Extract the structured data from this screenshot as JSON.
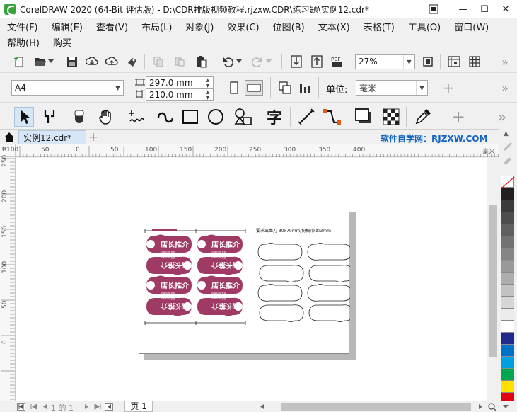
{
  "window": {
    "title": "CorelDRAW 2020 (64-Bit 评估版) - D:\\CDR排版视频教程.rjzxw.CDR\\练习题\\实例12.cdr*",
    "controls": {
      "restore": "▭",
      "minimize": "—",
      "maximize": "☐",
      "close": "✕"
    }
  },
  "menu": {
    "row1": [
      "文件(F)",
      "编辑(E)",
      "查看(V)",
      "布局(L)",
      "对象(J)",
      "效果(C)",
      "位图(B)",
      "文本(X)",
      "表格(T)",
      "工具(O)",
      "窗口(W)"
    ],
    "row2": [
      "帮助(H)",
      "购买"
    ]
  },
  "standard_toolbar": {
    "zoom": "27%",
    "more": "»"
  },
  "property_bar": {
    "page_size": "A4",
    "width": "297.0 mm",
    "height": "210.0 mm",
    "units_label": "单位:",
    "units_value": "毫米",
    "add": "+"
  },
  "toolbox": {
    "text_tool_glyph": "字",
    "add": "+",
    "more": "»"
  },
  "document_tab": {
    "name": "实例12.cdr*",
    "add": "+",
    "watermark": "软件自学网：RJZXW.COM"
  },
  "ruler": {
    "h_labels": [
      "100",
      "50",
      "0",
      "50",
      "100",
      "150",
      "200",
      "250",
      "300",
      "350",
      "400",
      "毫米"
    ],
    "v_labels": [
      "250",
      "200",
      "150",
      "100",
      "50",
      "0"
    ]
  },
  "page_content": {
    "note": "要求出血刀 30x70mm/份概/间距3mm",
    "brand_top": "店长推介",
    "brand_small": "VANXIAN 女装"
  },
  "status": {
    "page_counter": "1 的 1",
    "page_tab": "页 1"
  },
  "colors": {
    "accent_magenta": "#9e3a64",
    "tab_blue": "#d7e6f5",
    "watermark_blue": "#1565c0"
  },
  "palette": [
    "#231f20",
    "#3b3b3b",
    "#4d4d4d",
    "#5f5f5f",
    "#727272",
    "#858585",
    "#999999",
    "#adadad",
    "#c2c2c2",
    "#d6d6d6",
    "#ebebeb",
    "#ffffff",
    "#1f2a8a",
    "#0071c6",
    "#00a0e0",
    "#00a650",
    "#ffe000",
    "#e10012",
    "#e4007f",
    "#b8006f"
  ]
}
